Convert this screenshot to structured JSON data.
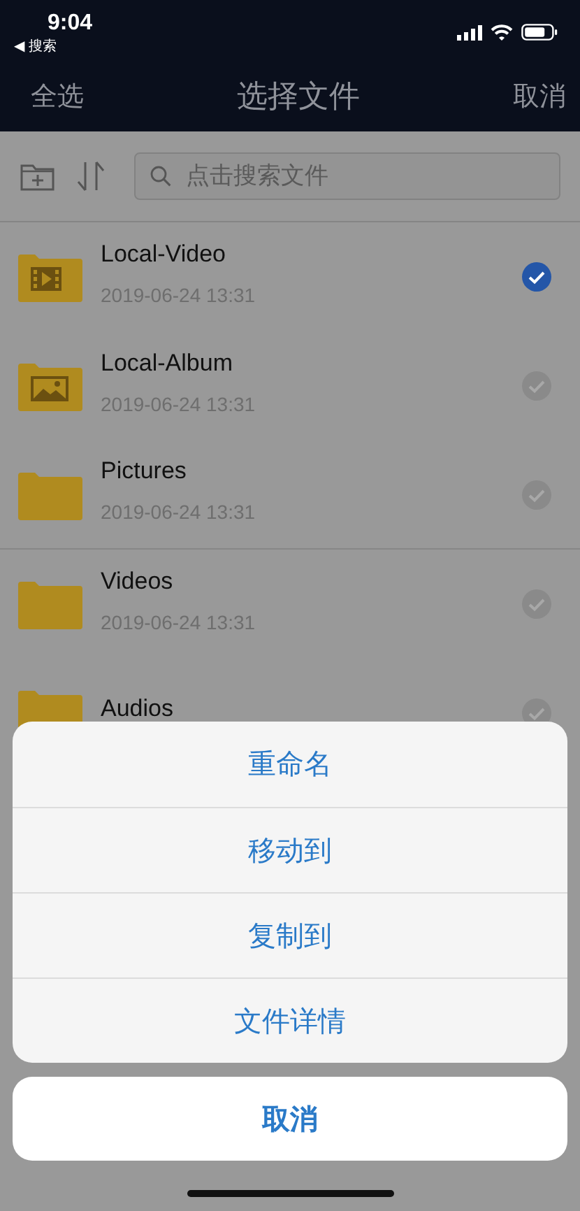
{
  "status_bar": {
    "time": "9:04",
    "back_label": "◀ 搜索"
  },
  "nav_bar": {
    "left": "全选",
    "title": "选择文件",
    "right": "取消"
  },
  "toolbar": {
    "search_placeholder": "点击搜索文件"
  },
  "files": [
    {
      "name": "Local-Video",
      "date": "2019-06-24 13:31",
      "kind": "video",
      "selected": true
    },
    {
      "name": "Local-Album",
      "date": "2019-06-24 13:31",
      "kind": "image",
      "selected": false
    },
    {
      "name": "Pictures",
      "date": "2019-06-24 13:31",
      "kind": "plain",
      "selected": false
    },
    {
      "name": "Videos",
      "date": "2019-06-24 13:31",
      "kind": "plain",
      "selected": false
    },
    {
      "name": "Audios",
      "kind": "plain",
      "selected": false
    }
  ],
  "action_sheet": {
    "actions": [
      "重命名",
      "移动到",
      "复制到",
      "文件详情"
    ],
    "cancel": "取消"
  }
}
